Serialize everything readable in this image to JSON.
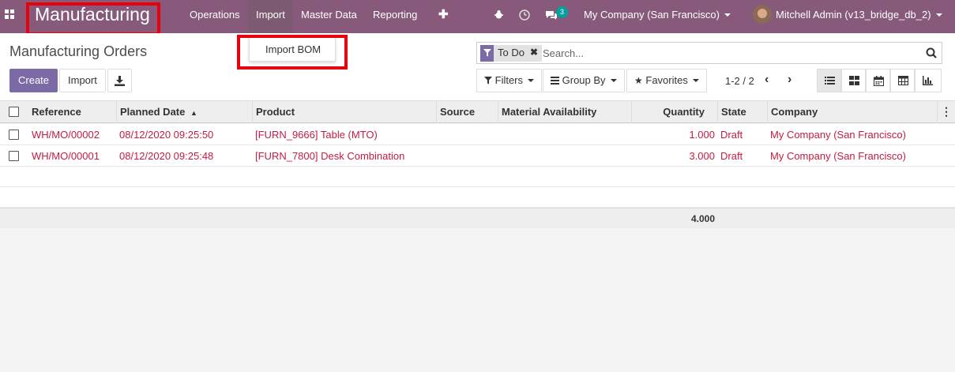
{
  "navbar": {
    "app_title": "Manufacturing",
    "menu": [
      "Operations",
      "Import",
      "Master Data",
      "Reporting"
    ],
    "active_menu": "Import",
    "plus_label": "✚",
    "chat_badge": "3",
    "company": "My Company (San Francisco)",
    "user": "Mitchell Admin (v13_bridge_db_2)"
  },
  "dropdown": {
    "items": [
      "Import BOM"
    ]
  },
  "control_panel": {
    "breadcrumb": "Manufacturing Orders",
    "create_label": "Create",
    "import_label": "Import",
    "search": {
      "facet_label": "To Do",
      "placeholder": "Search..."
    },
    "filters_label": "Filters",
    "groupby_label": "Group By",
    "favorites_label": "Favorites",
    "pager": "1-2 / 2",
    "views": [
      "list-icon",
      "kanban-icon",
      "calendar-icon",
      "pivot-icon",
      "graph-icon"
    ]
  },
  "table": {
    "columns": [
      "Reference",
      "Planned Date",
      "Product",
      "Source",
      "Material Availability",
      "Quantity",
      "State",
      "Company"
    ],
    "rows": [
      {
        "reference": "WH/MO/00002",
        "planned_date": "08/12/2020 09:25:50",
        "product": "[FURN_9666] Table (MTO)",
        "source": "",
        "material": "",
        "quantity": "1.000",
        "state": "Draft",
        "company": "My Company (San Francisco)"
      },
      {
        "reference": "WH/MO/00001",
        "planned_date": "08/12/2020 09:25:48",
        "product": "[FURN_7800] Desk Combination",
        "source": "",
        "material": "",
        "quantity": "3.000",
        "state": "Draft",
        "company": "My Company (San Francisco)"
      }
    ],
    "total_quantity": "4.000"
  },
  "colors": {
    "navbar": "#875a7b",
    "primary": "#7b6aa5",
    "row_text": "#c41c40",
    "highlight_box": "#e8000b"
  }
}
